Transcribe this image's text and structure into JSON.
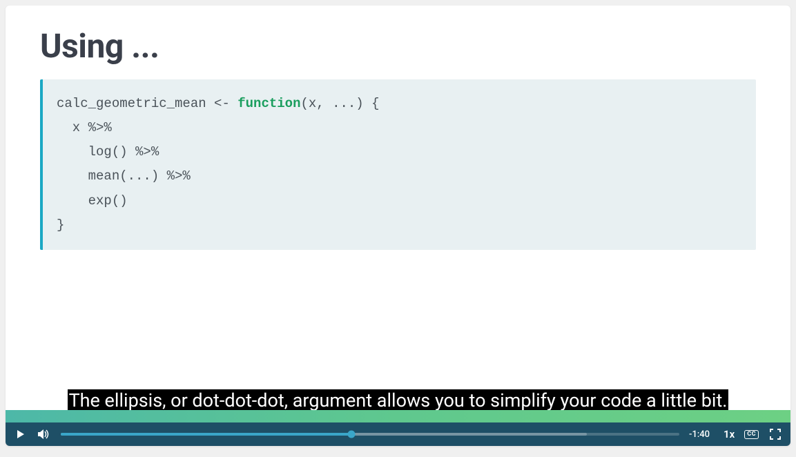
{
  "slide": {
    "title": "Using ...",
    "code": {
      "line1_pre": "calc_geometric_mean <- ",
      "line1_keyword": "function",
      "line1_post": "(x, ...) {",
      "line2": "  x %>%",
      "line3": "    log() %>%",
      "line4": "    mean(...) %>%",
      "line5": "    exp()",
      "line6": "}"
    }
  },
  "subtitle": {
    "text": "The ellipsis, or dot-dot-dot, argument allows you to simplify your code a little bit."
  },
  "player": {
    "time_remaining": "-1:40",
    "speed": "1x",
    "cc_label": "CC",
    "progress_played_pct": "47",
    "progress_buffered_pct": "85"
  }
}
